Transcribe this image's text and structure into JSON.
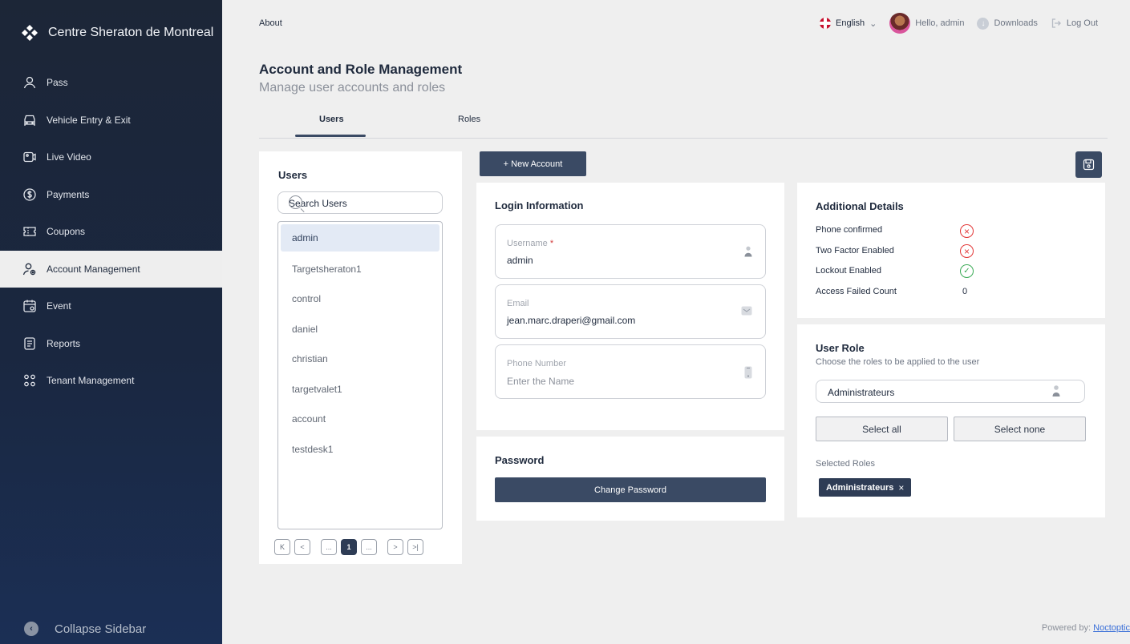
{
  "brand": {
    "name": "Centre Sheraton de Montreal"
  },
  "sidebar": {
    "items": [
      {
        "label": "Pass",
        "icon": "user-icon"
      },
      {
        "label": "Vehicle Entry & Exit",
        "icon": "car-icon"
      },
      {
        "label": "Live Video",
        "icon": "camera-icon"
      },
      {
        "label": "Payments",
        "icon": "dollar-icon"
      },
      {
        "label": "Coupons",
        "icon": "ticket-icon"
      },
      {
        "label": "Account Management",
        "icon": "user-gear-icon",
        "active": true
      },
      {
        "label": "Event",
        "icon": "calendar-icon"
      },
      {
        "label": "Reports",
        "icon": "report-icon"
      },
      {
        "label": "Tenant Management",
        "icon": "users-icon"
      }
    ],
    "collapse_label": "Collapse Sidebar"
  },
  "topbar": {
    "about": "About",
    "language": "English",
    "greeting": "Hello, admin",
    "downloads": "Downloads",
    "logout": "Log Out"
  },
  "page": {
    "title": "Account and Role Management",
    "subtitle": "Manage user accounts and roles"
  },
  "tabs": {
    "users": "Users",
    "roles": "Roles",
    "active": "Users"
  },
  "users_panel": {
    "heading": "Users",
    "search_placeholder": "Search Users",
    "users": [
      "admin",
      "Targetsheraton1",
      "control",
      "daniel",
      "christian",
      "targetvalet1",
      "account",
      "testdesk1"
    ],
    "selected": "admin",
    "pager": {
      "first": "K",
      "prev": "<",
      "ellipsis": "...",
      "current": "1",
      "next": ">",
      "last": ">|"
    }
  },
  "actions": {
    "new_account": "+ New Account"
  },
  "login_info": {
    "heading": "Login Information",
    "username_label": "Username",
    "username_required": "*",
    "username_value": "admin",
    "email_label": "Email",
    "email_value": "jean.marc.draperi@gmail.com",
    "phone_label": "Phone Number",
    "phone_placeholder": "Enter the Name"
  },
  "password": {
    "heading": "Password",
    "button": "Change Password"
  },
  "additional": {
    "heading": "Additional Details",
    "phone_confirmed_label": "Phone confirmed",
    "phone_confirmed": false,
    "two_factor_label": "Two Factor Enabled",
    "two_factor": false,
    "lockout_label": "Lockout Enabled",
    "lockout": true,
    "access_failed_label": "Access Failed Count",
    "access_failed_count": "0"
  },
  "user_role": {
    "heading": "User Role",
    "description": "Choose the roles to be applied to the user",
    "selected_value": "Administrateurs",
    "select_all": "Select all",
    "select_none": "Select none",
    "selected_heading": "Selected Roles",
    "selected_chips": [
      "Administrateurs"
    ],
    "chip_remove": "×"
  },
  "footer": {
    "powered_by": "Powered by:",
    "vendor": "Noctoptic"
  },
  "colors": {
    "primary": "#3a4a64",
    "sidebar": "#1c2637",
    "error": "#e23636",
    "success": "#3aaa55"
  }
}
